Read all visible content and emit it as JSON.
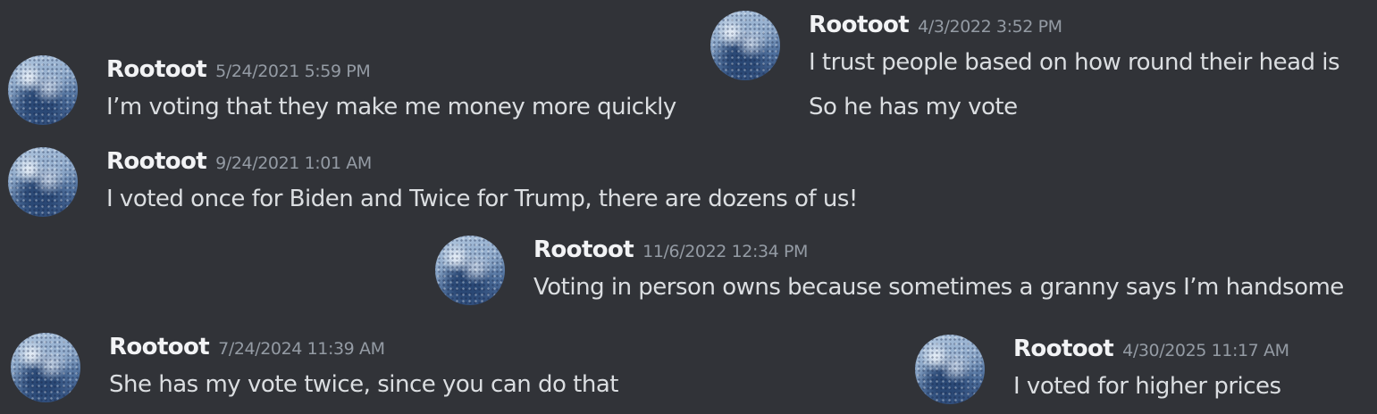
{
  "messages": [
    {
      "username": "Rootoot",
      "timestamp": "4/3/2022 3:52 PM",
      "lines": [
        "I trust people based on how round their head is",
        "So he has my vote"
      ]
    },
    {
      "username": "Rootoot",
      "timestamp": "5/24/2021 5:59 PM",
      "lines": [
        "I’m voting that they make me money more quickly"
      ]
    },
    {
      "username": "Rootoot",
      "timestamp": "9/24/2021 1:01 AM",
      "lines": [
        "I voted once for Biden and Twice for Trump, there are dozens of us!"
      ]
    },
    {
      "username": "Rootoot",
      "timestamp": "11/6/2022 12:34 PM",
      "lines": [
        "Voting in person owns because sometimes a granny says I’m handsome"
      ]
    },
    {
      "username": "Rootoot",
      "timestamp": "7/24/2024 11:39 AM",
      "lines": [
        "She has my vote twice, since you can do that"
      ]
    },
    {
      "username": "Rootoot",
      "timestamp": "4/30/2025 11:17 AM",
      "lines": [
        "I voted for higher prices"
      ]
    }
  ]
}
